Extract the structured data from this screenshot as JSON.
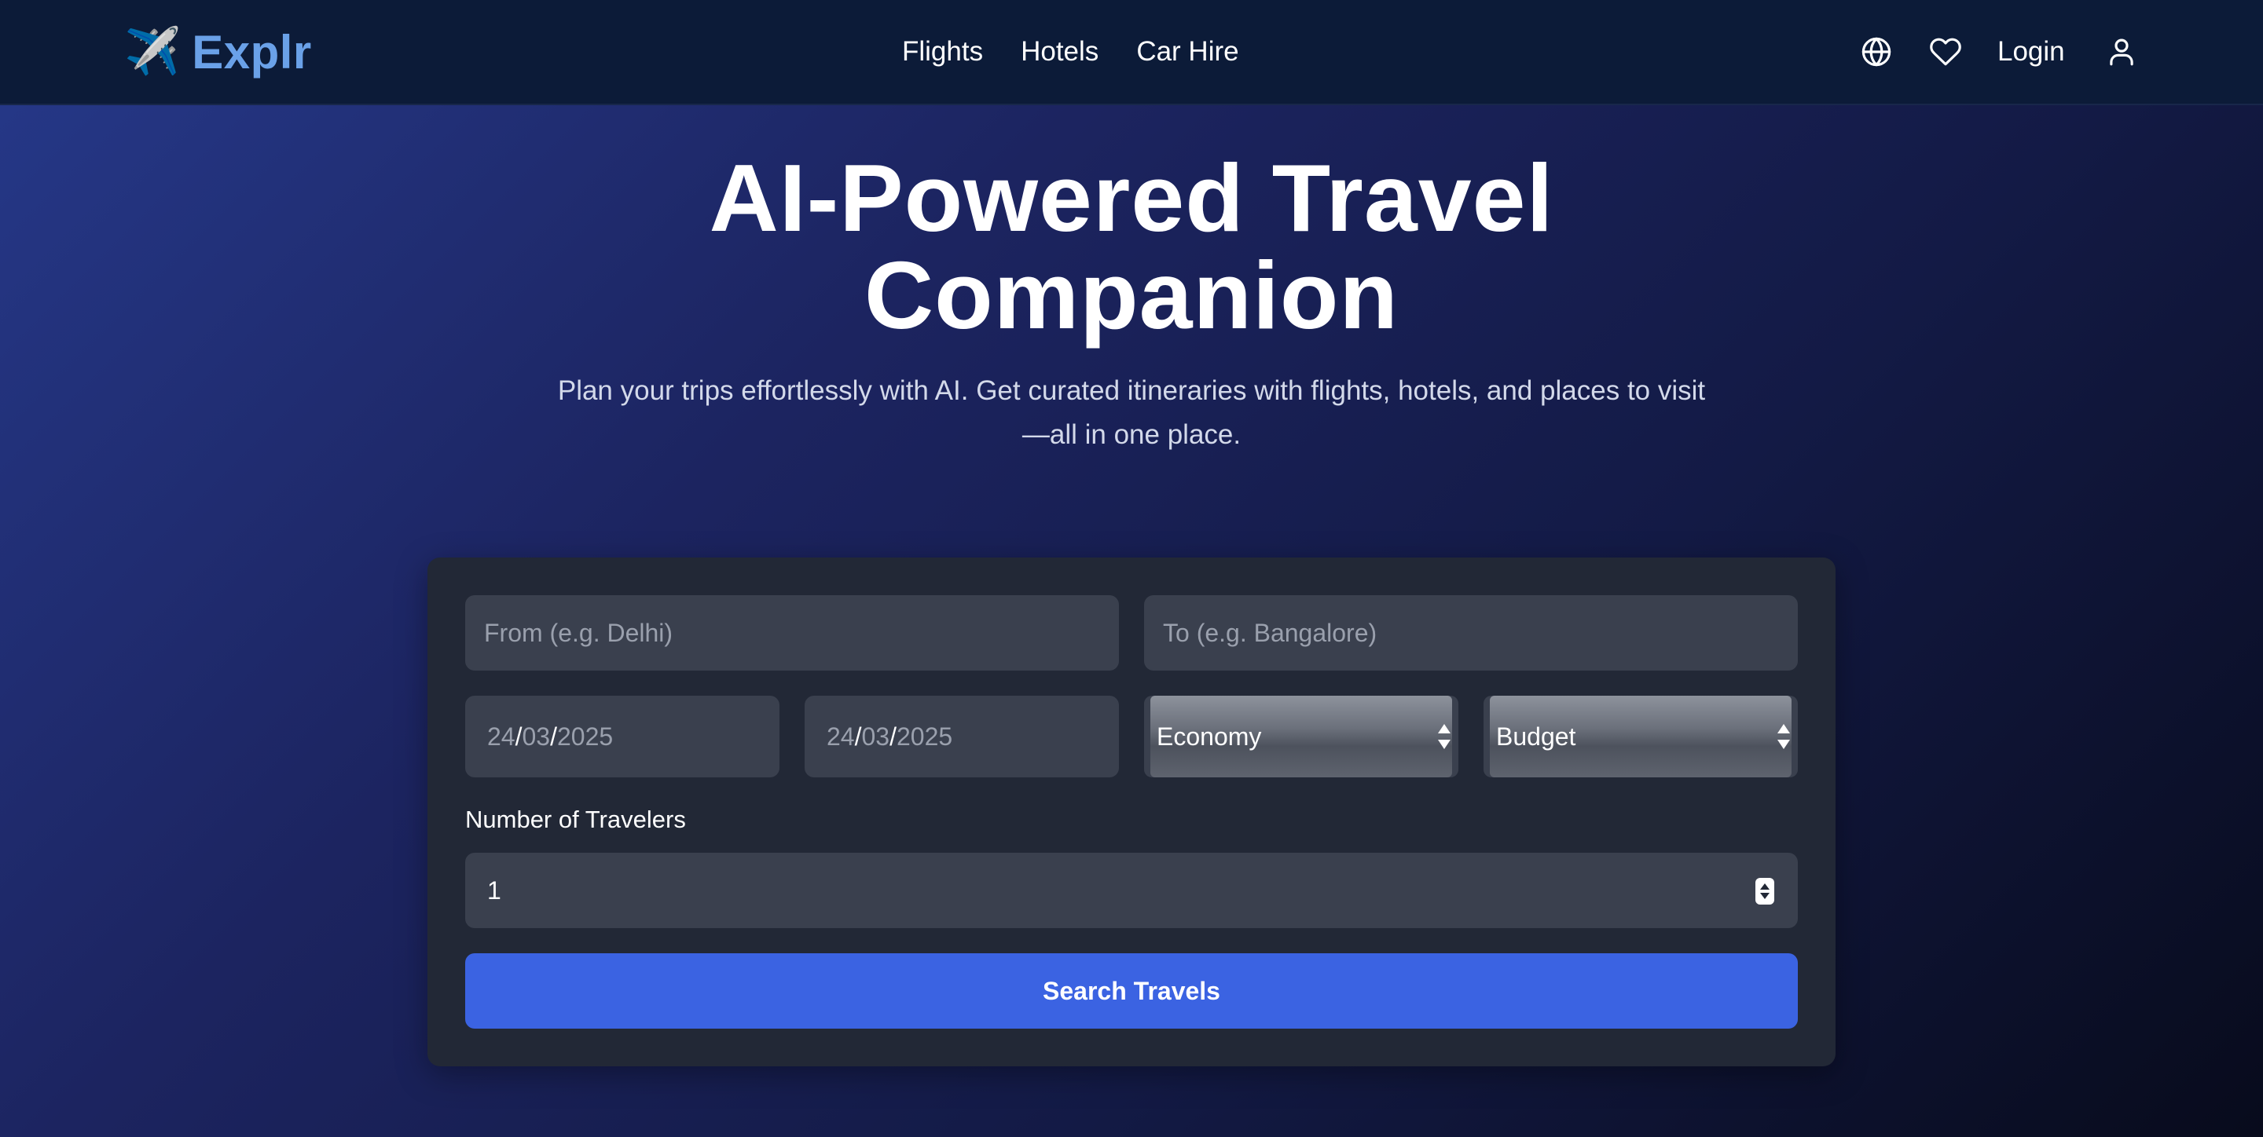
{
  "navbar": {
    "logo_icon": "airplane-icon",
    "logo_glyph": "✈️",
    "logo_text": "Explr",
    "links": [
      "Flights",
      "Hotels",
      "Car Hire"
    ],
    "login_label": "Login",
    "icons": [
      "globe-icon",
      "heart-icon",
      "user-icon"
    ]
  },
  "hero": {
    "title_line1": "AI-Powered Travel",
    "title_line2": "Companion",
    "subtitle_line1": "Plan your trips effortlessly with AI. Get curated itineraries with flights, hotels, and places to visit",
    "subtitle_line2": "—all in one place."
  },
  "search_form": {
    "from_placeholder": "From (e.g. Delhi)",
    "to_placeholder": "To (e.g. Bangalore)",
    "depart_date": {
      "day": "24",
      "month": "03",
      "year": "2025"
    },
    "return_date": {
      "day": "24",
      "month": "03",
      "year": "2025"
    },
    "date_separator": "/",
    "travel_class": "Economy",
    "budget": "Budget",
    "travelers_label": "Number of Travelers",
    "travelers_value": "1",
    "search_button_label": "Search Travels"
  },
  "colors": {
    "navbar_bg": "#0c1b38",
    "logo": "#6aa1e8",
    "card_bg": "#222836",
    "field_bg": "#3a404e",
    "primary_button": "#3b63e2"
  }
}
